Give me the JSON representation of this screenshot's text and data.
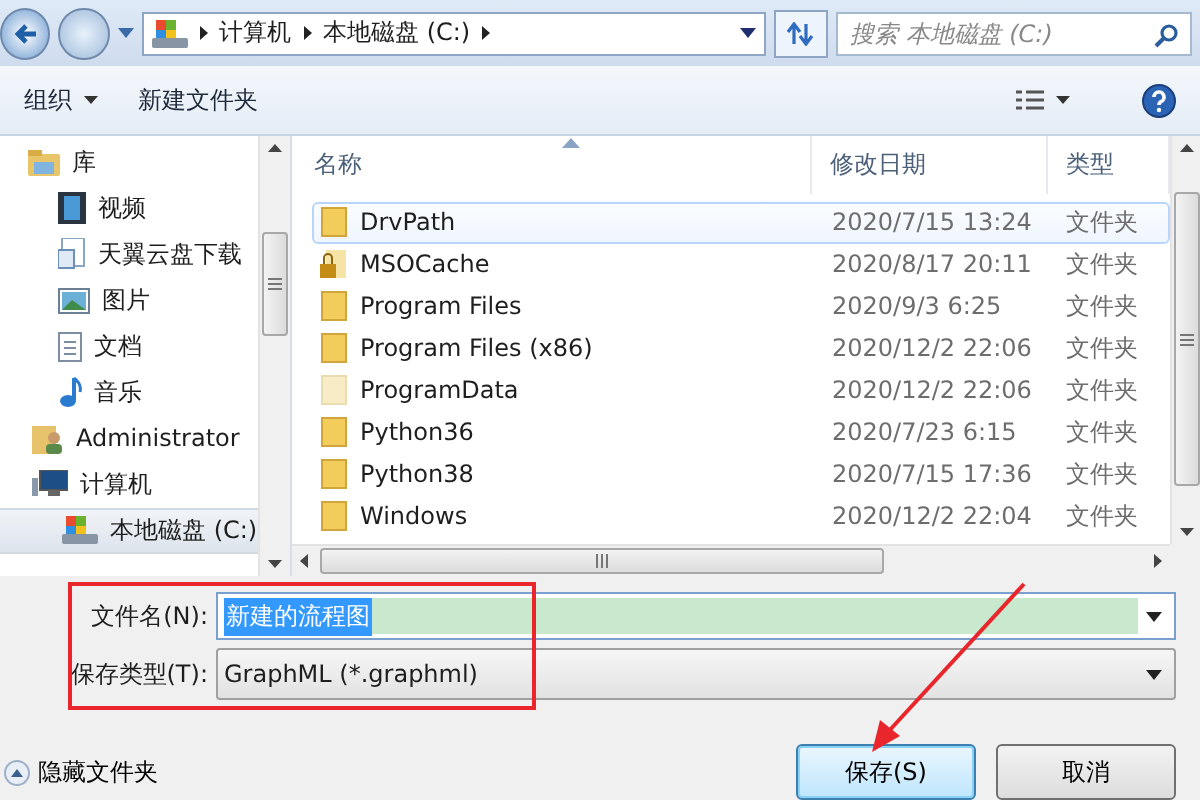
{
  "address_bar": {
    "segments": [
      "计算机",
      "本地磁盘 (C:)"
    ],
    "search_placeholder": "搜索 本地磁盘 (C:)"
  },
  "toolbar": {
    "organize": "组织",
    "new_folder": "新建文件夹"
  },
  "nav": [
    {
      "label": "库",
      "kind": "library",
      "selected": false,
      "children": [
        {
          "label": "视频",
          "kind": "video",
          "selected": false
        },
        {
          "label": "天翼云盘下载",
          "kind": "download",
          "selected": false
        },
        {
          "label": "图片",
          "kind": "picture",
          "selected": false
        },
        {
          "label": "文档",
          "kind": "document",
          "selected": false
        },
        {
          "label": "音乐",
          "kind": "music",
          "selected": false
        }
      ]
    },
    {
      "label": "Administrator",
      "kind": "user",
      "selected": false
    },
    {
      "label": "计算机",
      "kind": "computer",
      "selected": false,
      "children": [
        {
          "label": "本地磁盘 (C:)",
          "kind": "drive",
          "selected": true
        }
      ]
    }
  ],
  "file_list": {
    "columns": [
      "名称",
      "修改日期",
      "类型"
    ],
    "rows": [
      {
        "name": "DrvPath",
        "date": "2020/7/15 13:24",
        "type": "文件夹",
        "kind": "folder",
        "selected": true
      },
      {
        "name": "MSOCache",
        "date": "2020/8/17 20:11",
        "type": "文件夹",
        "kind": "locked",
        "selected": false
      },
      {
        "name": "Program Files",
        "date": "2020/9/3 6:25",
        "type": "文件夹",
        "kind": "folder",
        "selected": false
      },
      {
        "name": "Program Files (x86)",
        "date": "2020/12/2 22:06",
        "type": "文件夹",
        "kind": "folder",
        "selected": false
      },
      {
        "name": "ProgramData",
        "date": "2020/12/2 22:06",
        "type": "文件夹",
        "kind": "hidden",
        "selected": false
      },
      {
        "name": "Python36",
        "date": "2020/7/23 6:15",
        "type": "文件夹",
        "kind": "folder",
        "selected": false
      },
      {
        "name": "Python38",
        "date": "2020/7/15 17:36",
        "type": "文件夹",
        "kind": "folder",
        "selected": false
      },
      {
        "name": "Windows",
        "date": "2020/12/2 22:04",
        "type": "文件夹",
        "kind": "folder",
        "selected": false
      }
    ]
  },
  "save_form": {
    "filename_label": "文件名(N):",
    "filename_value": "新建的流程图",
    "type_label": "保存类型(T):",
    "type_value": "GraphML (*.graphml)"
  },
  "hide_folders": "隐藏文件夹",
  "buttons": [
    {
      "label": "保存(S)",
      "default": true
    },
    {
      "label": "取消",
      "default": false
    }
  ]
}
